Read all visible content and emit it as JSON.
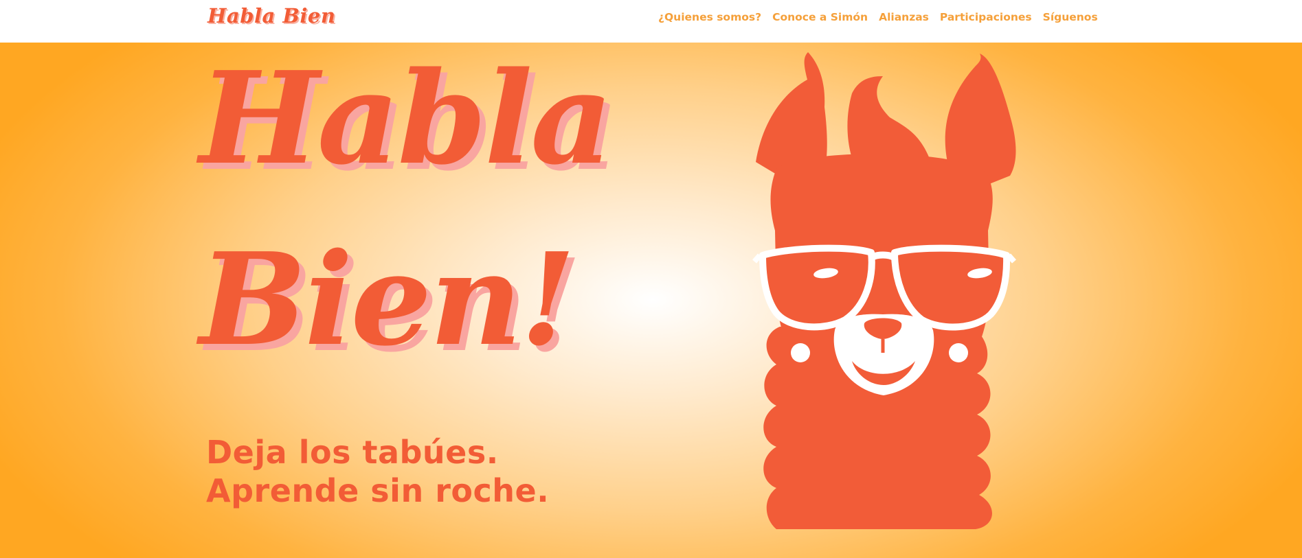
{
  "header": {
    "logo_text": "Habla Bien",
    "nav": [
      {
        "label": "¿Quienes somos?"
      },
      {
        "label": "Conoce a Simón"
      },
      {
        "label": "Alianzas"
      },
      {
        "label": "Participaciones"
      },
      {
        "label": "Síguenos"
      }
    ]
  },
  "hero": {
    "title_line1": "Habla",
    "title_line2": "Bien!",
    "tagline_line1": "Deja los tabúes.",
    "tagline_line2": "Aprende sin roche.",
    "llama_icon": "llama-with-sunglasses-icon"
  },
  "colors": {
    "brand": "#f25c36",
    "nav_text": "#f5a03a",
    "background_gradient_center": "#ffffff",
    "background_gradient_edge": "#ffa722",
    "shadow": "#f9a5a0"
  }
}
